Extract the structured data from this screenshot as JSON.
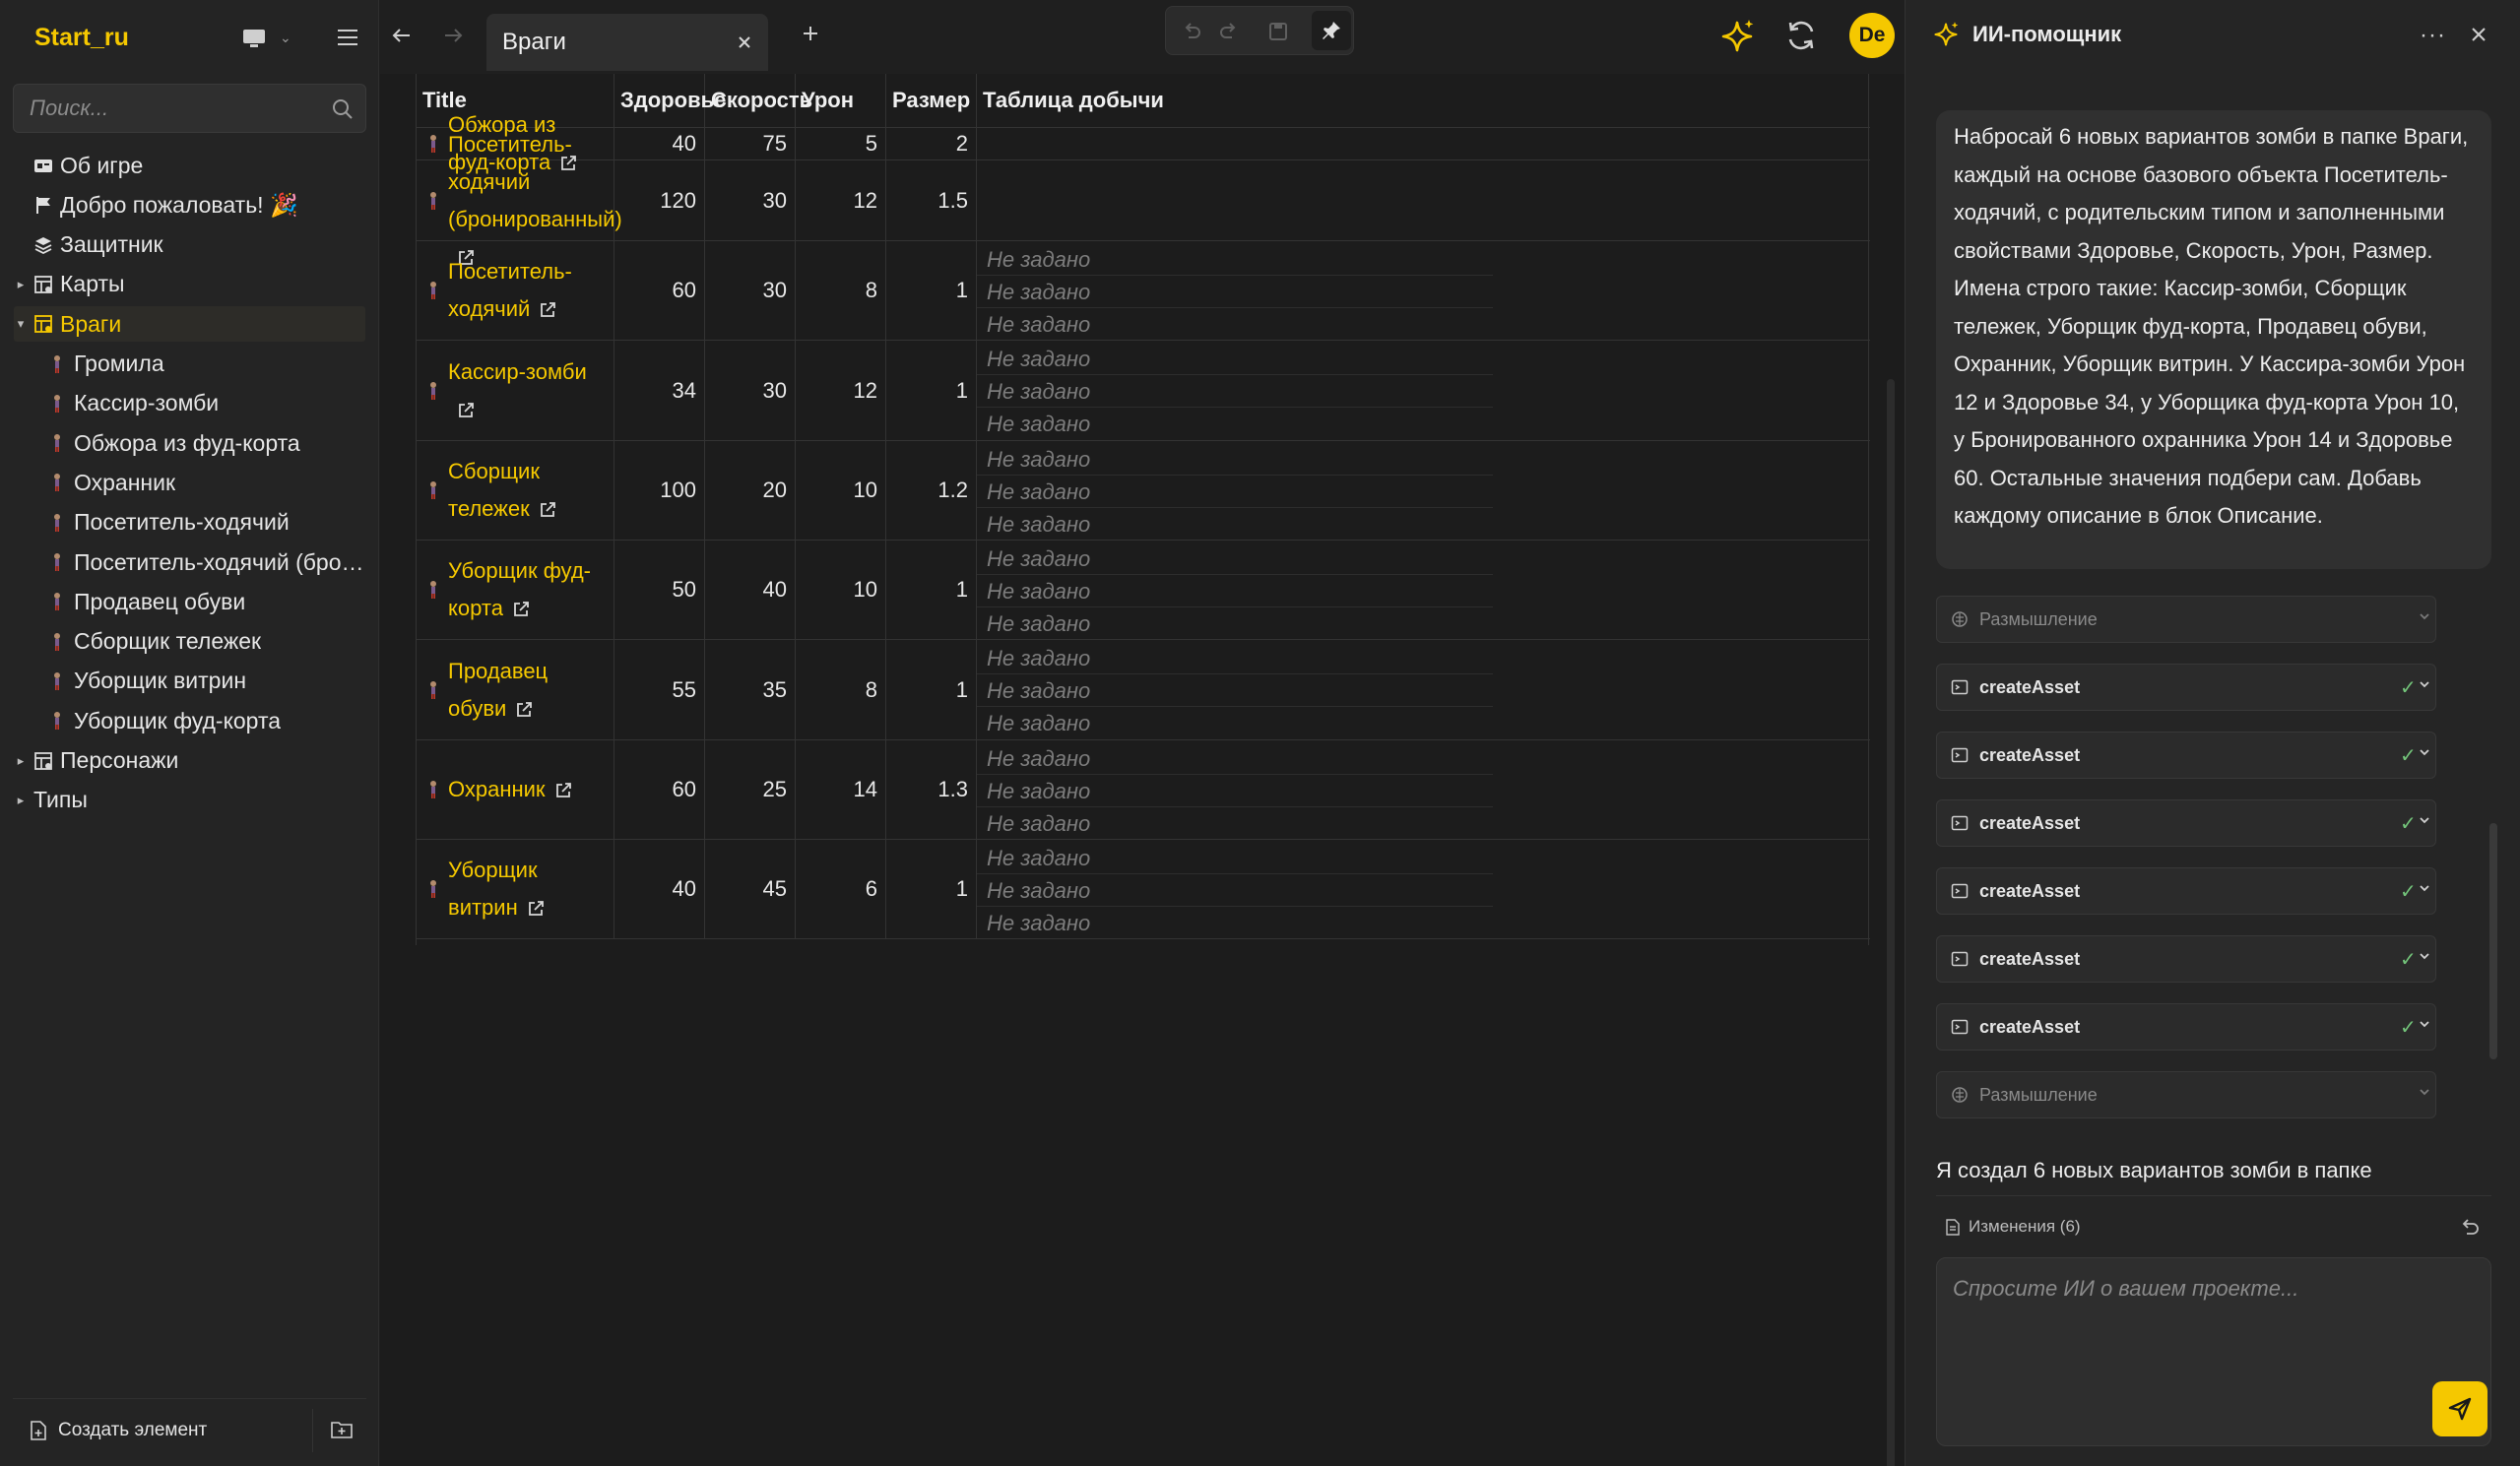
{
  "sidebar": {
    "app_name": "Start_ru",
    "search_placeholder": "Поиск...",
    "items": [
      {
        "label": "Об игре",
        "level": 0
      },
      {
        "label": "Добро пожаловать! 🎉",
        "level": 0
      },
      {
        "label": "Защитник",
        "level": 0
      },
      {
        "label": "Карты",
        "level": 0,
        "caret": "▸"
      },
      {
        "label": "Враги",
        "level": 0,
        "caret": "▾",
        "selected": true
      },
      {
        "label": "Громила",
        "level": 1
      },
      {
        "label": "Кассир-зомби",
        "level": 1
      },
      {
        "label": "Обжора из фуд-корта",
        "level": 1
      },
      {
        "label": "Охранник",
        "level": 1
      },
      {
        "label": "Посетитель-ходячий",
        "level": 1
      },
      {
        "label": "Посетитель-ходячий (бронированный)",
        "level": 1
      },
      {
        "label": "Продавец обуви",
        "level": 1
      },
      {
        "label": "Сборщик тележек",
        "level": 1
      },
      {
        "label": "Уборщик витрин",
        "level": 1
      },
      {
        "label": "Уборщик фуд-корта",
        "level": 1
      },
      {
        "label": "Персонажи",
        "level": 0,
        "caret": "▸"
      },
      {
        "label": "Типы",
        "level": 0,
        "caret": "▸"
      }
    ],
    "create_label": "Создать элемент"
  },
  "topbar": {
    "tab_title": "Враги",
    "avatar_initials": "De"
  },
  "table": {
    "columns": [
      "Title",
      "Здоровье",
      "Скорость",
      "Урон",
      "Размер",
      "Таблица добычи"
    ],
    "empty_label": "Не задано",
    "rows": [
      {
        "title": "Обжора из фуд-корта",
        "health": "40",
        "speed": "75",
        "damage": "5",
        "size": "2",
        "loot_lines": 0
      },
      {
        "title": "Посетитель-ходячий (бронированный)",
        "health": "120",
        "speed": "30",
        "damage": "12",
        "size": "1.5",
        "loot_lines": 0
      },
      {
        "title": "Посетитель-ходячий",
        "health": "60",
        "speed": "30",
        "damage": "8",
        "size": "1",
        "loot_lines": 3
      },
      {
        "title": "Кассир-зомби",
        "health": "34",
        "speed": "30",
        "damage": "12",
        "size": "1",
        "loot_lines": 3
      },
      {
        "title": "Сборщик тележек",
        "health": "100",
        "speed": "20",
        "damage": "10",
        "size": "1.2",
        "loot_lines": 3
      },
      {
        "title": "Уборщик фуд-корта",
        "health": "50",
        "speed": "40",
        "damage": "10",
        "size": "1",
        "loot_lines": 3
      },
      {
        "title": "Продавец обуви",
        "health": "55",
        "speed": "35",
        "damage": "8",
        "size": "1",
        "loot_lines": 3
      },
      {
        "title": "Охранник",
        "health": "60",
        "speed": "25",
        "damage": "14",
        "size": "1.3",
        "loot_lines": 3
      },
      {
        "title": "Уборщик витрин",
        "health": "40",
        "speed": "45",
        "damage": "6",
        "size": "1",
        "loot_lines": 3
      }
    ]
  },
  "ai": {
    "title": "ИИ-помощник",
    "more": "···",
    "user_message": "Набросай 6 новых вариантов зомби в папке Враги, каждый на основе базового объекта Посетитель-ходячий, с родительским типом и заполненными свойствами Здоровье, Скорость, Урон, Размер. Имена строго такие: Кассир-зомби, Сборщик тележек, Уборщик фуд-корта, Продавец обуви, Охранник, Уборщик витрин. У Кассира-зомби Урон 12 и Здоровье 34, у Уборщика фуд-корта Урон 10, у Бронированного охранника Урон 14 и Здоровье 60. Остальные значения подбери сам. Добавь каждому описание в блок Описание.",
    "steps": [
      {
        "name": "Размышление",
        "kind": "think"
      },
      {
        "name": "createAsset",
        "kind": "tool",
        "check": "✓"
      },
      {
        "name": "createAsset",
        "kind": "tool",
        "check": "✓"
      },
      {
        "name": "createAsset",
        "kind": "tool",
        "check": "✓"
      },
      {
        "name": "createAsset",
        "kind": "tool",
        "check": "✓"
      },
      {
        "name": "createAsset",
        "kind": "tool",
        "check": "✓"
      },
      {
        "name": "createAsset",
        "kind": "tool",
        "check": "✓"
      },
      {
        "name": "Размышление",
        "kind": "think"
      }
    ],
    "reply": "Я создал 6 новых вариантов зомби в папке",
    "changes_label": "Изменения (6)",
    "input_placeholder": "Спросите ИИ о вашем проекте..."
  },
  "colors": {
    "accent": "#f5c800",
    "bg": "#1f1f1f",
    "sidebar_bg": "#242424",
    "muted": "#7c7c7c",
    "check": "#73c47a"
  }
}
